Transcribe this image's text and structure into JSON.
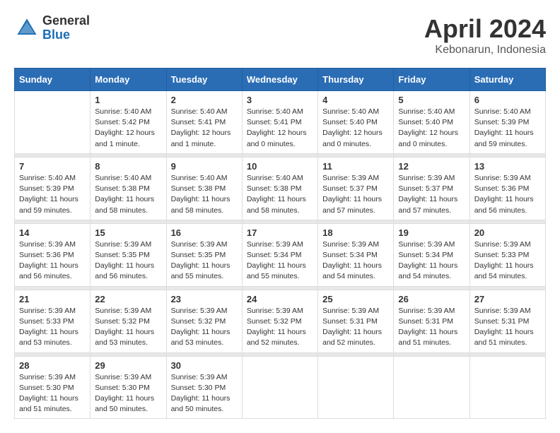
{
  "header": {
    "logo_general": "General",
    "logo_blue": "Blue",
    "month_title": "April 2024",
    "location": "Kebonarun, Indonesia"
  },
  "weekdays": [
    "Sunday",
    "Monday",
    "Tuesday",
    "Wednesday",
    "Thursday",
    "Friday",
    "Saturday"
  ],
  "weeks": [
    [
      {
        "day": "",
        "info": ""
      },
      {
        "day": "1",
        "info": "Sunrise: 5:40 AM\nSunset: 5:42 PM\nDaylight: 12 hours\nand 1 minute."
      },
      {
        "day": "2",
        "info": "Sunrise: 5:40 AM\nSunset: 5:41 PM\nDaylight: 12 hours\nand 1 minute."
      },
      {
        "day": "3",
        "info": "Sunrise: 5:40 AM\nSunset: 5:41 PM\nDaylight: 12 hours\nand 0 minutes."
      },
      {
        "day": "4",
        "info": "Sunrise: 5:40 AM\nSunset: 5:40 PM\nDaylight: 12 hours\nand 0 minutes."
      },
      {
        "day": "5",
        "info": "Sunrise: 5:40 AM\nSunset: 5:40 PM\nDaylight: 12 hours\nand 0 minutes."
      },
      {
        "day": "6",
        "info": "Sunrise: 5:40 AM\nSunset: 5:39 PM\nDaylight: 11 hours\nand 59 minutes."
      }
    ],
    [
      {
        "day": "7",
        "info": "Sunrise: 5:40 AM\nSunset: 5:39 PM\nDaylight: 11 hours\nand 59 minutes."
      },
      {
        "day": "8",
        "info": "Sunrise: 5:40 AM\nSunset: 5:38 PM\nDaylight: 11 hours\nand 58 minutes."
      },
      {
        "day": "9",
        "info": "Sunrise: 5:40 AM\nSunset: 5:38 PM\nDaylight: 11 hours\nand 58 minutes."
      },
      {
        "day": "10",
        "info": "Sunrise: 5:40 AM\nSunset: 5:38 PM\nDaylight: 11 hours\nand 58 minutes."
      },
      {
        "day": "11",
        "info": "Sunrise: 5:39 AM\nSunset: 5:37 PM\nDaylight: 11 hours\nand 57 minutes."
      },
      {
        "day": "12",
        "info": "Sunrise: 5:39 AM\nSunset: 5:37 PM\nDaylight: 11 hours\nand 57 minutes."
      },
      {
        "day": "13",
        "info": "Sunrise: 5:39 AM\nSunset: 5:36 PM\nDaylight: 11 hours\nand 56 minutes."
      }
    ],
    [
      {
        "day": "14",
        "info": "Sunrise: 5:39 AM\nSunset: 5:36 PM\nDaylight: 11 hours\nand 56 minutes."
      },
      {
        "day": "15",
        "info": "Sunrise: 5:39 AM\nSunset: 5:35 PM\nDaylight: 11 hours\nand 56 minutes."
      },
      {
        "day": "16",
        "info": "Sunrise: 5:39 AM\nSunset: 5:35 PM\nDaylight: 11 hours\nand 55 minutes."
      },
      {
        "day": "17",
        "info": "Sunrise: 5:39 AM\nSunset: 5:34 PM\nDaylight: 11 hours\nand 55 minutes."
      },
      {
        "day": "18",
        "info": "Sunrise: 5:39 AM\nSunset: 5:34 PM\nDaylight: 11 hours\nand 54 minutes."
      },
      {
        "day": "19",
        "info": "Sunrise: 5:39 AM\nSunset: 5:34 PM\nDaylight: 11 hours\nand 54 minutes."
      },
      {
        "day": "20",
        "info": "Sunrise: 5:39 AM\nSunset: 5:33 PM\nDaylight: 11 hours\nand 54 minutes."
      }
    ],
    [
      {
        "day": "21",
        "info": "Sunrise: 5:39 AM\nSunset: 5:33 PM\nDaylight: 11 hours\nand 53 minutes."
      },
      {
        "day": "22",
        "info": "Sunrise: 5:39 AM\nSunset: 5:32 PM\nDaylight: 11 hours\nand 53 minutes."
      },
      {
        "day": "23",
        "info": "Sunrise: 5:39 AM\nSunset: 5:32 PM\nDaylight: 11 hours\nand 53 minutes."
      },
      {
        "day": "24",
        "info": "Sunrise: 5:39 AM\nSunset: 5:32 PM\nDaylight: 11 hours\nand 52 minutes."
      },
      {
        "day": "25",
        "info": "Sunrise: 5:39 AM\nSunset: 5:31 PM\nDaylight: 11 hours\nand 52 minutes."
      },
      {
        "day": "26",
        "info": "Sunrise: 5:39 AM\nSunset: 5:31 PM\nDaylight: 11 hours\nand 51 minutes."
      },
      {
        "day": "27",
        "info": "Sunrise: 5:39 AM\nSunset: 5:31 PM\nDaylight: 11 hours\nand 51 minutes."
      }
    ],
    [
      {
        "day": "28",
        "info": "Sunrise: 5:39 AM\nSunset: 5:30 PM\nDaylight: 11 hours\nand 51 minutes."
      },
      {
        "day": "29",
        "info": "Sunrise: 5:39 AM\nSunset: 5:30 PM\nDaylight: 11 hours\nand 50 minutes."
      },
      {
        "day": "30",
        "info": "Sunrise: 5:39 AM\nSunset: 5:30 PM\nDaylight: 11 hours\nand 50 minutes."
      },
      {
        "day": "",
        "info": ""
      },
      {
        "day": "",
        "info": ""
      },
      {
        "day": "",
        "info": ""
      },
      {
        "day": "",
        "info": ""
      }
    ]
  ]
}
